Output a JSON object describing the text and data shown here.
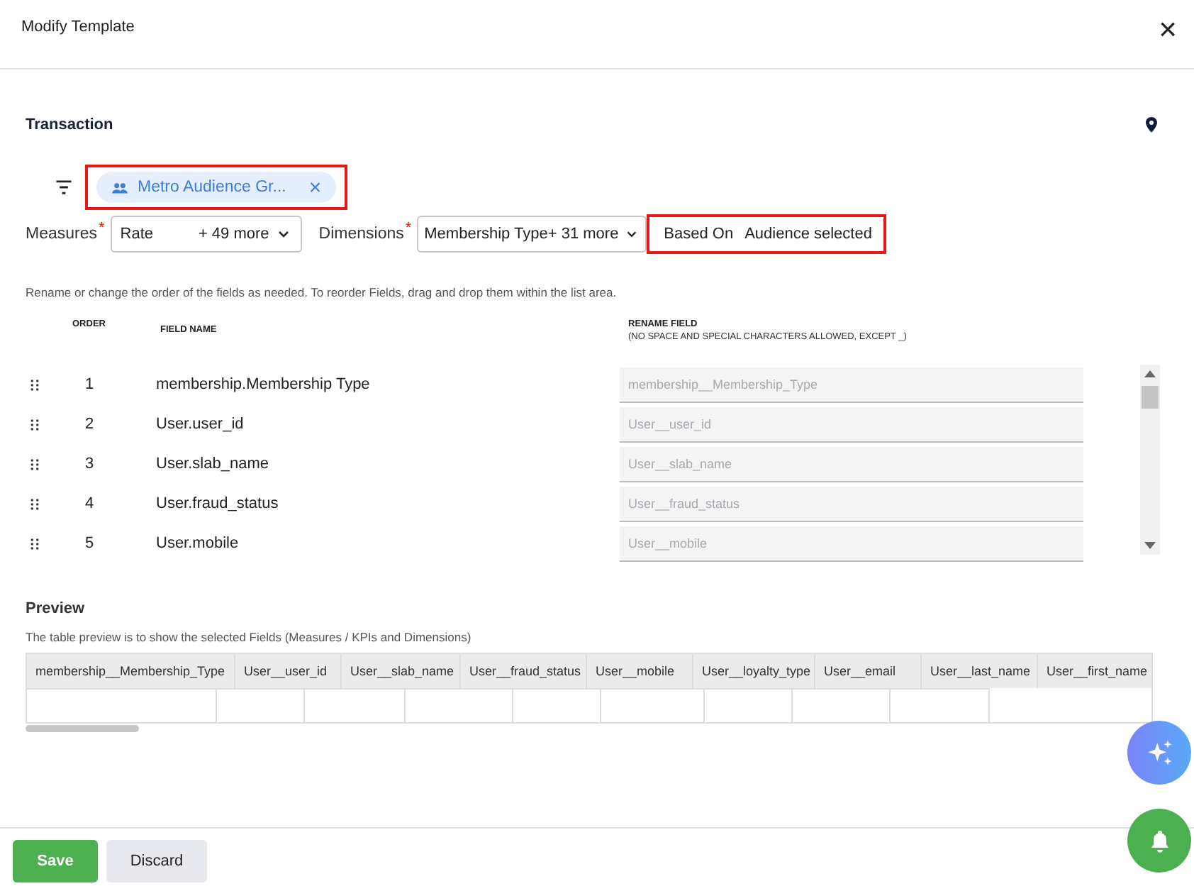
{
  "dialog": {
    "title": "Modify Template",
    "close": "×"
  },
  "section": {
    "title": "Transaction"
  },
  "audience_chip": {
    "label": "Metro Audience Gr...",
    "remove": "×",
    "highlighted": true
  },
  "measures": {
    "label": "Measures",
    "required_mark": "*",
    "value": "Rate",
    "more": "+ 49 more"
  },
  "dimensions": {
    "label": "Dimensions",
    "required_mark": "*",
    "value": "Membership Type",
    "more": "+ 31 more"
  },
  "based_on": {
    "label": "Based On",
    "value": "Audience selected",
    "highlighted": true
  },
  "instructions": "Rename or change the order of the fields as needed. To reorder Fields, drag and drop them within the list area.",
  "fields_table": {
    "columns": {
      "order": "ORDER",
      "field_name": "FIELD NAME",
      "rename": "RENAME FIELD",
      "rename_hint": "(NO SPACE AND SPECIAL CHARACTERS ALLOWED, EXCEPT _)"
    },
    "rows": [
      {
        "order": "1",
        "field_name": "membership.Membership Type",
        "placeholder": "membership__Membership_Type"
      },
      {
        "order": "2",
        "field_name": "User.user_id",
        "placeholder": "User__user_id"
      },
      {
        "order": "3",
        "field_name": "User.slab_name",
        "placeholder": "User__slab_name"
      },
      {
        "order": "4",
        "field_name": "User.fraud_status",
        "placeholder": "User__fraud_status"
      },
      {
        "order": "5",
        "field_name": "User.mobile",
        "placeholder": "User__mobile"
      }
    ]
  },
  "preview": {
    "title": "Preview",
    "description": "The table preview is to show the selected Fields (Measures / KPIs and Dimensions)",
    "columns": [
      "membership__Membership_Type",
      "User__user_id",
      "User__slab_name",
      "User__fraud_status",
      "User__mobile",
      "User__loyalty_type",
      "User__email",
      "User__last_name",
      "User__first_name"
    ]
  },
  "footer": {
    "buttons": [
      {
        "label": "Save",
        "kind": "primary"
      },
      {
        "label": "Discard",
        "kind": "secondary"
      }
    ]
  }
}
